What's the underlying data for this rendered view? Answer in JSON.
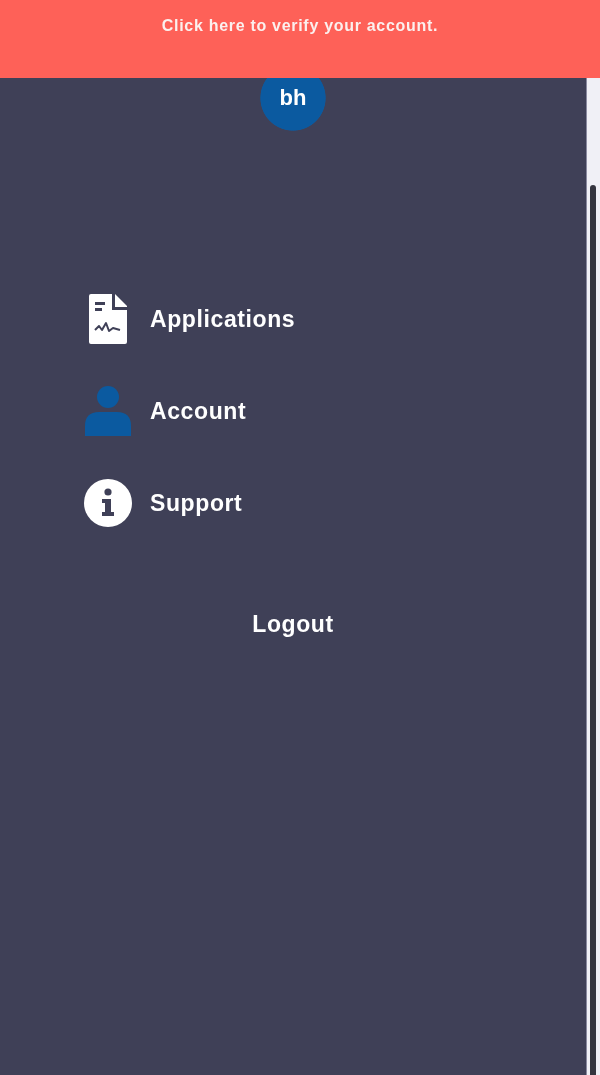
{
  "banner": {
    "text": "Click here to verify your account."
  },
  "avatar": {
    "initials": "bh"
  },
  "menu": [
    {
      "kind": "document",
      "label": "Applications"
    },
    {
      "kind": "person",
      "label": "Account"
    },
    {
      "kind": "info",
      "label": "Support"
    }
  ],
  "logout": {
    "label": "Logout"
  }
}
